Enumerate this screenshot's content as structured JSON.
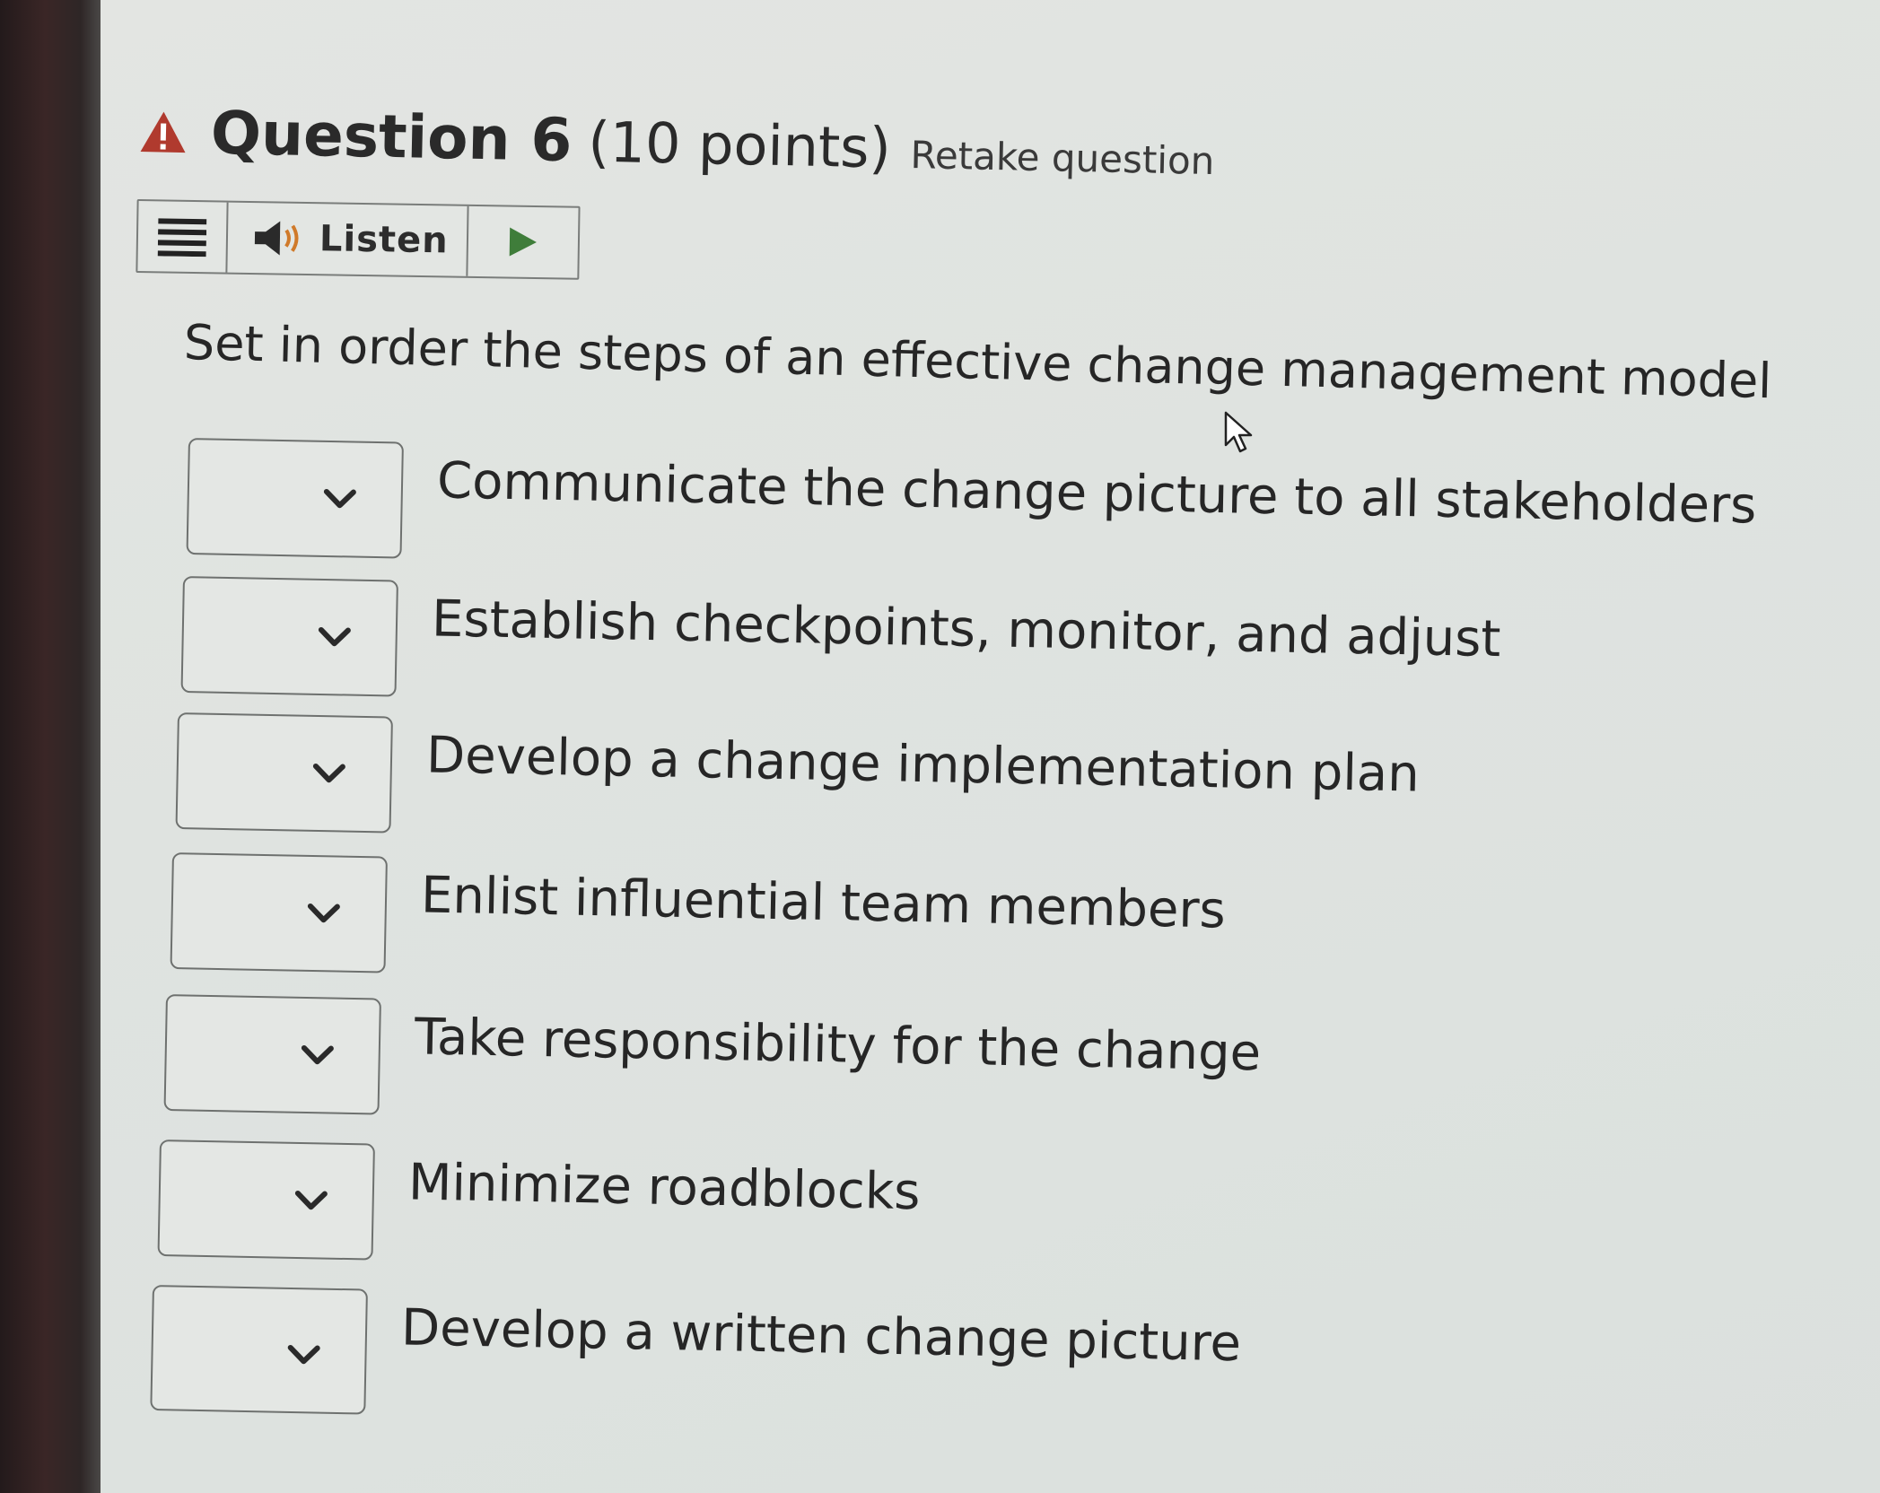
{
  "question": {
    "title": "Question 6",
    "points": "(10 points)",
    "retake_label": "Retake question"
  },
  "toolbar": {
    "menu_icon": "hamburger-icon",
    "speaker_icon": "speaker-icon",
    "listen_label": "Listen",
    "play_icon": "play-icon",
    "play_color": "#3f7d3a"
  },
  "prompt": "Set in order the steps of an effective change management model",
  "items": [
    {
      "label": "Communicate the change picture to all stakeholders",
      "selected": ""
    },
    {
      "label": "Establish checkpoints, monitor, and adjust",
      "selected": ""
    },
    {
      "label": "Develop a change implementation plan",
      "selected": ""
    },
    {
      "label": "Enlist influential team members",
      "selected": ""
    },
    {
      "label": "Take responsibility for the change",
      "selected": ""
    },
    {
      "label": "Minimize roadblocks",
      "selected": ""
    },
    {
      "label": "Develop a written change picture",
      "selected": ""
    }
  ],
  "colors": {
    "warning": "#b03a2e",
    "text": "#262626",
    "border": "#6e716f"
  }
}
